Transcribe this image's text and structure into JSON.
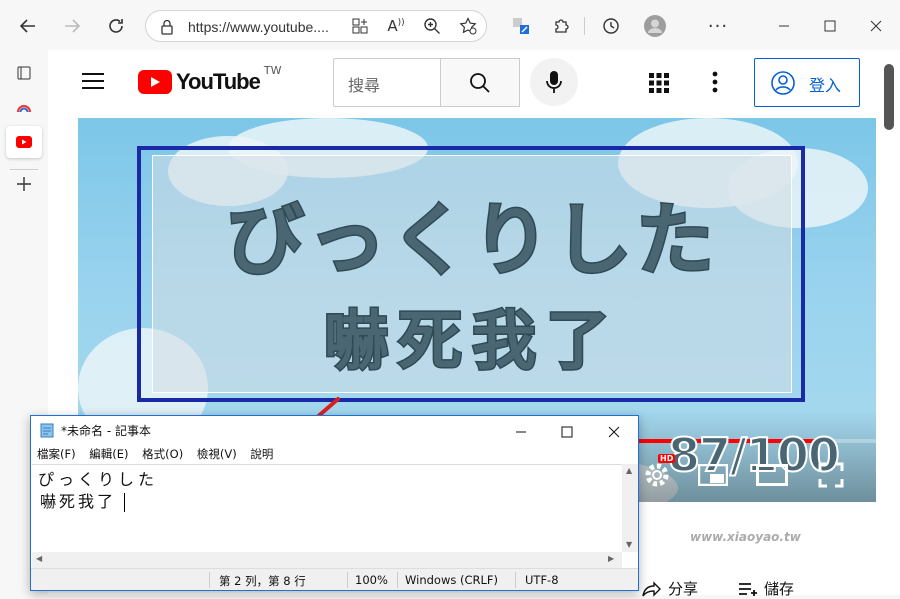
{
  "browser": {
    "url": "https://www.youtube....",
    "sidebar_tab": "YouTube"
  },
  "youtube": {
    "logo_text": "YouTube",
    "region": "TW",
    "search_placeholder": "搜尋",
    "signin_label": "登入"
  },
  "video": {
    "caption_line1": "びっくりした",
    "caption_line2": "嚇死我了",
    "counter": "87/100",
    "hd_badge": "HD",
    "progress": 0.8
  },
  "below_video": {
    "share_label": "分享",
    "save_label": "儲存"
  },
  "notepad": {
    "title": "*未命名 - 記事本",
    "menu": [
      "檔案(F)",
      "編輯(E)",
      "格式(O)",
      "檢視(V)",
      "說明"
    ],
    "text_line1": "ぴっくりした",
    "text_line2": "嚇死我了",
    "status_position": "第 2 列，第 8 行",
    "status_zoom": "100%",
    "status_eol": "Windows (CRLF)",
    "status_encoding": "UTF-8"
  },
  "watermark": {
    "site": "www.xiaoyao.tw"
  },
  "colors": {
    "yt_red": "#ff0000",
    "link_blue": "#065fd4",
    "caption_border": "#1a2aa6",
    "arrow_red": "#d92020"
  }
}
